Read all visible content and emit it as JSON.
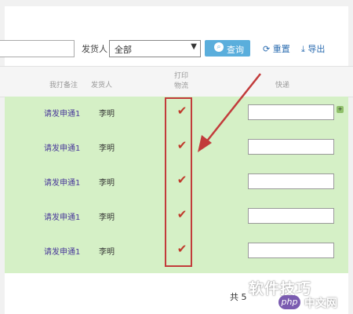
{
  "toolbar": {
    "sender_label": "发货人",
    "sender_select_value": "全部",
    "query_label": "查询",
    "reset_label": "重置",
    "export_label": "导出"
  },
  "table": {
    "headers": {
      "remark": "我打备注",
      "sender": "发货人",
      "print_line1": "打印",
      "print_line2": "物流",
      "express": "快递"
    },
    "rows": [
      {
        "remark": "请发申通1",
        "sender": "李明",
        "check": "✔"
      },
      {
        "remark": "请发申通1",
        "sender": "李明",
        "check": "✔"
      },
      {
        "remark": "请发申通1",
        "sender": "李明",
        "check": "✔"
      },
      {
        "remark": "请发申通1",
        "sender": "李明",
        "check": "✔"
      },
      {
        "remark": "请发申通1",
        "sender": "李明",
        "check": "✔"
      }
    ]
  },
  "footer": {
    "total_text": "共 5"
  },
  "watermark": {
    "text": "软件技巧",
    "badge": "php",
    "site": "中文网"
  },
  "colors": {
    "row_highlight": "#d5f0c6",
    "annotation_red": "#c23b3b",
    "button_blue": "#5aaedc"
  }
}
